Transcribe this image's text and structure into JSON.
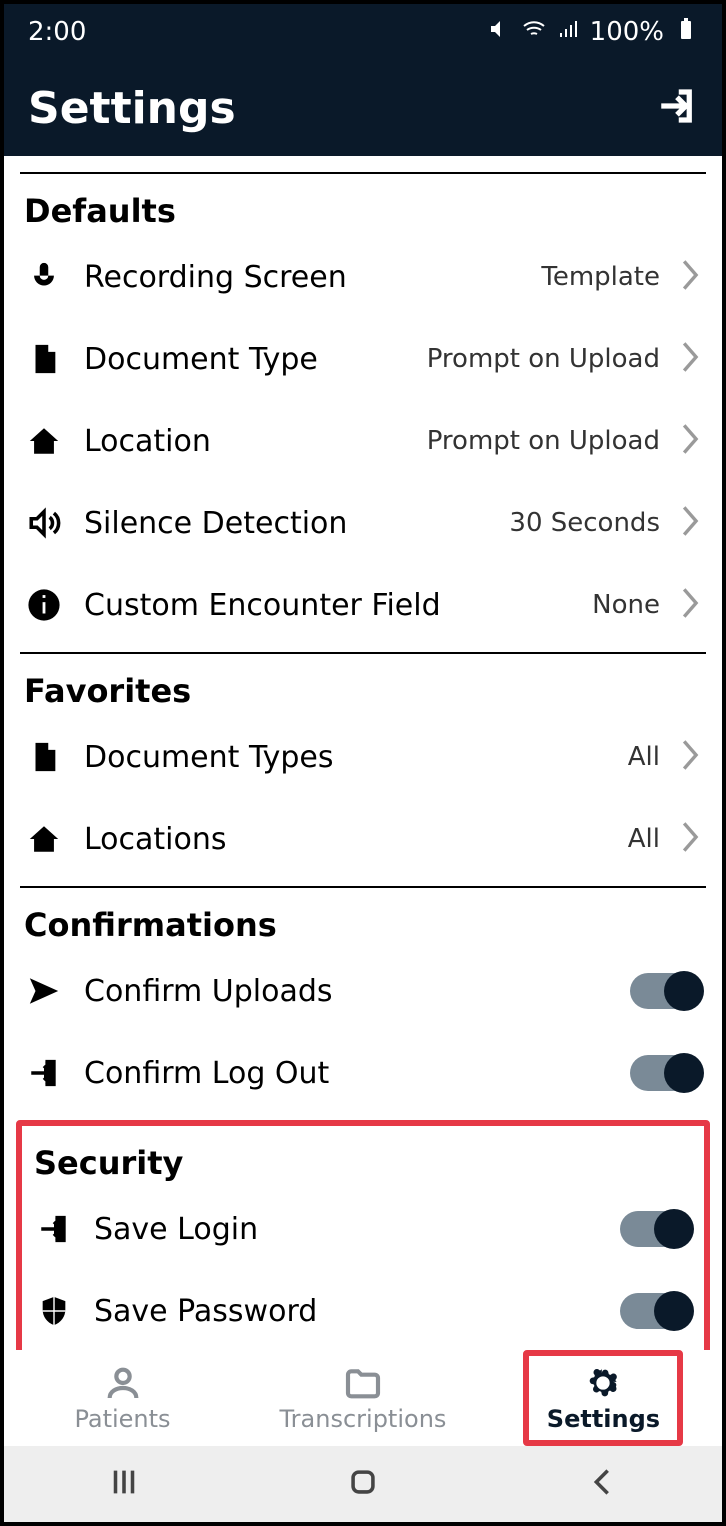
{
  "statusbar": {
    "time": "2:00",
    "battery": "100%"
  },
  "header": {
    "title": "Settings"
  },
  "sections": {
    "defaults": {
      "title": "Defaults",
      "recording_screen": {
        "label": "Recording Screen",
        "value": "Template"
      },
      "document_type": {
        "label": "Document Type",
        "value": "Prompt on Upload"
      },
      "location": {
        "label": "Location",
        "value": "Prompt on Upload"
      },
      "silence_detection": {
        "label": "Silence Detection",
        "value": "30 Seconds"
      },
      "custom_encounter": {
        "label": "Custom Encounter Field",
        "value": "None"
      }
    },
    "favorites": {
      "title": "Favorites",
      "document_types": {
        "label": "Document Types",
        "value": "All"
      },
      "locations": {
        "label": "Locations",
        "value": "All"
      }
    },
    "confirmations": {
      "title": "Confirmations",
      "confirm_uploads": {
        "label": "Confirm Uploads",
        "on": true
      },
      "confirm_logout": {
        "label": "Confirm Log Out",
        "on": true
      }
    },
    "security": {
      "title": "Security",
      "save_login": {
        "label": "Save Login",
        "on": true
      },
      "save_password": {
        "label": "Save Password",
        "on": true
      }
    }
  },
  "tabs": {
    "patients": "Patients",
    "transcriptions": "Transcriptions",
    "settings": "Settings"
  }
}
